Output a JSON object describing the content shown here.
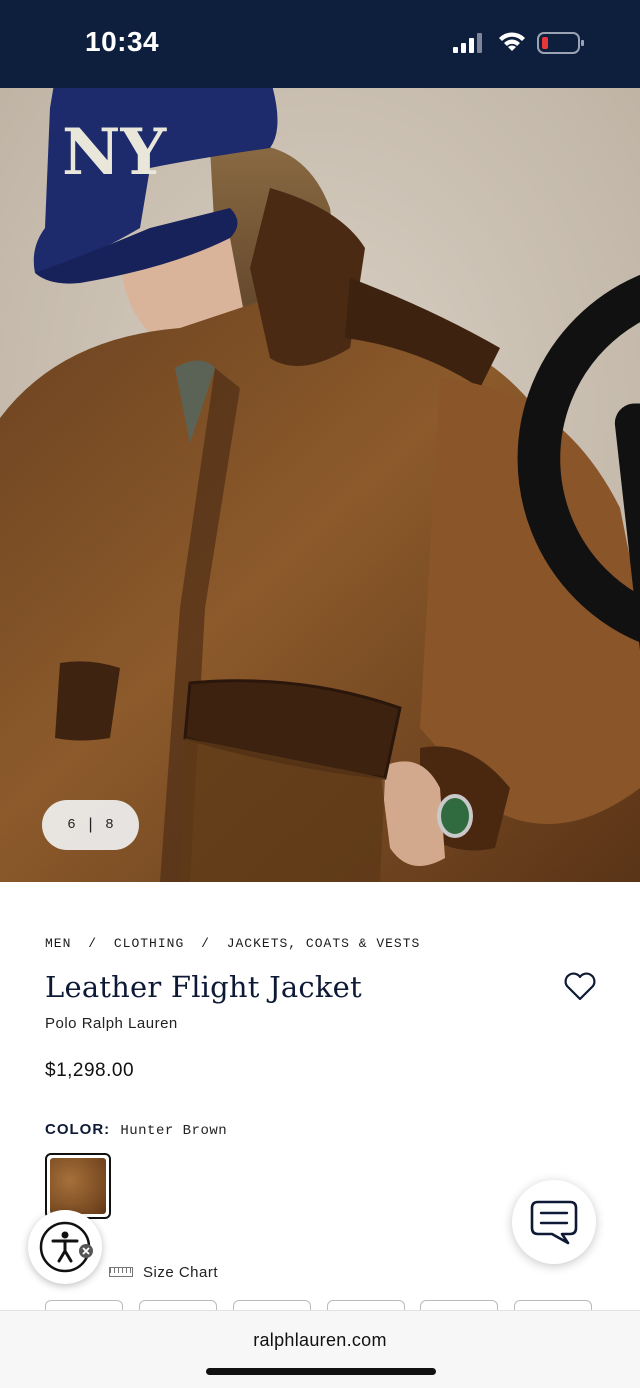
{
  "status_bar": {
    "time": "10:34"
  },
  "gallery": {
    "current": "6",
    "separator": "|",
    "total": "8"
  },
  "header_icons": [
    "search-icon",
    "shopping-bag-icon",
    "menu-icon"
  ],
  "breadcrumb": {
    "items": [
      "MEN",
      "CLOTHING",
      "JACKETS, COATS & VESTS"
    ],
    "separator": "/"
  },
  "product": {
    "title": "Leather Flight Jacket",
    "brand": "Polo Ralph Lauren",
    "price": "$1,298.00",
    "color_label": "COLOR:",
    "color_value": "Hunter Brown",
    "size_chart_label": "Size Chart"
  },
  "browser": {
    "url": "ralphlauren.com"
  },
  "colors": {
    "navy": "#0e1f3d",
    "jacket": "#7a4b22",
    "cap": "#1d2a6b"
  }
}
